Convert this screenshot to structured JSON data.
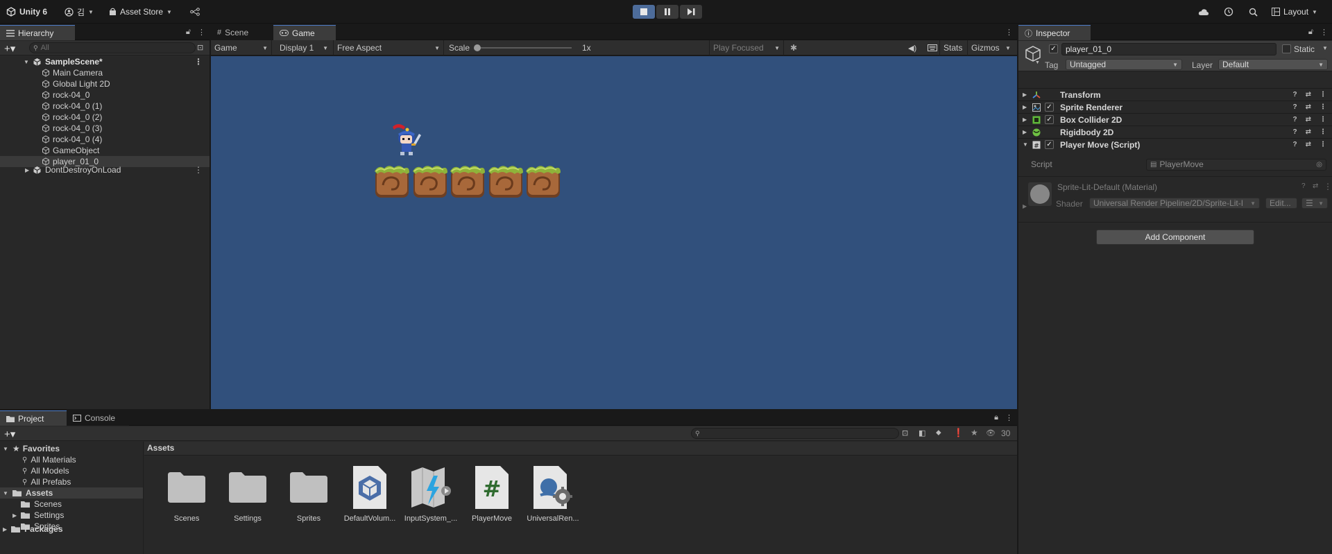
{
  "toolbar": {
    "unity_label": "Unity 6",
    "account_label": "김",
    "asset_store_label": "Asset Store",
    "layout_label": "Layout"
  },
  "hierarchy": {
    "tab": "Hierarchy",
    "search_placeholder": "All",
    "scene": "SampleScene*",
    "items": [
      "Main Camera",
      "Global Light 2D",
      "rock-04_0",
      "rock-04_0 (1)",
      "rock-04_0 (2)",
      "rock-04_0 (3)",
      "rock-04_0 (4)",
      "GameObject",
      "player_01_0"
    ],
    "selected": "player_01_0",
    "dont_destroy": "DontDestroyOnLoad"
  },
  "game": {
    "tabs": [
      "Scene",
      "Game"
    ],
    "active_tab": "Game",
    "view_dropdown": "Game",
    "display": "Display 1",
    "aspect": "Free Aspect",
    "scale_label": "Scale",
    "scale_value": "1x",
    "play_focused": "Play Focused",
    "stats": "Stats",
    "gizmos": "Gizmos",
    "background_color": "#31507c"
  },
  "inspector": {
    "tab": "Inspector",
    "object_name": "player_01_0",
    "static_label": "Static",
    "tag_label": "Tag",
    "tag_value": "Untagged",
    "layer_label": "Layer",
    "layer_value": "Default",
    "components": [
      {
        "name": "Transform",
        "icon": "transform-icon",
        "checkbox": false
      },
      {
        "name": "Sprite Renderer",
        "icon": "sprite-renderer-icon",
        "checkbox": true
      },
      {
        "name": "Box Collider 2D",
        "icon": "box-collider-icon",
        "checkbox": true
      },
      {
        "name": "Rigidbody 2D",
        "icon": "rigidbody-icon",
        "checkbox": false
      },
      {
        "name": "Player Move (Script)",
        "icon": "script-icon",
        "checkbox": true
      }
    ],
    "script_label": "Script",
    "script_value": "PlayerMove",
    "material_name": "Sprite-Lit-Default (Material)",
    "shader_label": "Shader",
    "shader_value": "Universal Render Pipeline/2D/Sprite-Lit-I",
    "edit_label": "Edit...",
    "add_component": "Add Component"
  },
  "project": {
    "tabs": [
      "Project",
      "Console"
    ],
    "active_tab": "Project",
    "count": "30",
    "favorites_label": "Favorites",
    "favorites": [
      "All Materials",
      "All Models",
      "All Prefabs"
    ],
    "assets_label": "Assets",
    "asset_folders": [
      "Scenes",
      "Settings",
      "Sprites"
    ],
    "packages_label": "Packages",
    "breadcrumb": "Assets",
    "grid": [
      {
        "label": "Scenes",
        "icon": "folder-icon"
      },
      {
        "label": "Settings",
        "icon": "folder-icon"
      },
      {
        "label": "Sprites",
        "icon": "folder-icon"
      },
      {
        "label": "DefaultVolum...",
        "icon": "volume-profile-icon"
      },
      {
        "label": "InputSystem_...",
        "icon": "input-actions-icon"
      },
      {
        "label": "PlayerMove",
        "icon": "csharp-script-icon"
      },
      {
        "label": "UniversalRen...",
        "icon": "render-pipeline-asset-icon"
      }
    ]
  }
}
